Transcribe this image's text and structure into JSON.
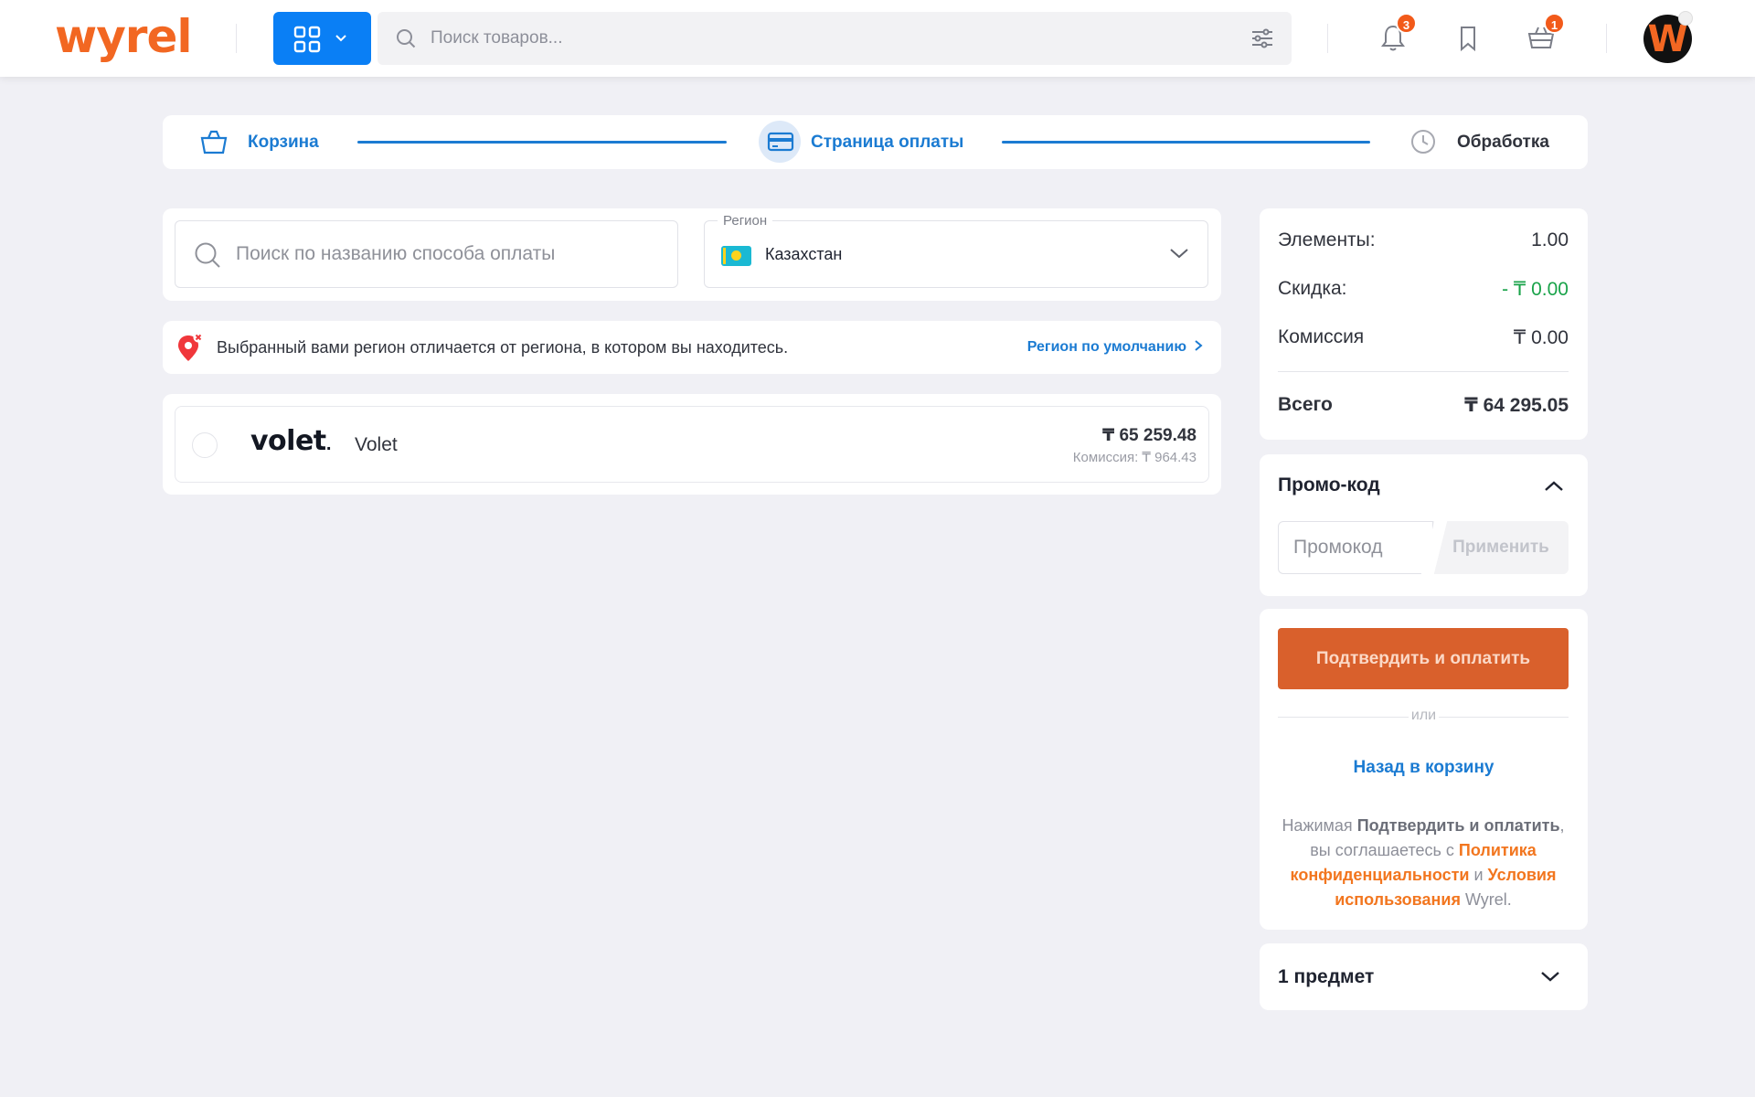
{
  "header": {
    "logo": "wyrel",
    "search": {
      "placeholder": "Поиск товаров..."
    },
    "notifications_count": "3",
    "cart_count": "1",
    "avatar_letter": "W"
  },
  "steps": [
    {
      "label": "Корзина",
      "icon": "basket-icon"
    },
    {
      "label": "Страница оплаты",
      "icon": "credit-card-icon"
    },
    {
      "label": "Обработка",
      "icon": "clock-icon"
    }
  ],
  "payment_filter": {
    "search_placeholder": "Поиск по названию способа оплаты",
    "region_label": "Регион",
    "region_value": "Казахстан"
  },
  "notice": {
    "text": "Выбранный вами регион отличается от региона, в котором вы находитесь.",
    "link": "Регион по умолчанию"
  },
  "methods": [
    {
      "logo": "volet",
      "name": "Volet",
      "amount": "₸ 65 259.48",
      "fee": "Комиссия: ₸ 964.43"
    }
  ],
  "summary": {
    "items_label": "Элементы:",
    "items_value": "1.00",
    "discount_label": "Скидка:",
    "discount_value": "- ₸ 0.00",
    "fee_label": "Комиссия",
    "fee_value": "₸ 0.00",
    "total_label": "Всего",
    "total_value": "₸ 64 295.05"
  },
  "promo": {
    "title": "Промо-код",
    "placeholder": "Промокод",
    "apply": "Применить"
  },
  "action": {
    "pay_button": "Подтвердить и оплатить",
    "or": "или",
    "back_link": "Назад в корзину",
    "legal_1": "Нажимая ",
    "legal_bold": "Подтвердить и оплатить",
    "legal_2": ", вы соглашаетесь с ",
    "privacy": "Политика конфиденциальности",
    "legal_3": " и ",
    "terms": "Условия использования",
    "legal_4": " Wyrel."
  },
  "items": {
    "title": "1 предмет"
  },
  "colors": {
    "brand_orange": "#f26722",
    "primary_blue": "#0a7ff5",
    "link_blue": "#1b7bd2",
    "pay_button": "#d9602c",
    "discount_green": "#1aa34a"
  }
}
